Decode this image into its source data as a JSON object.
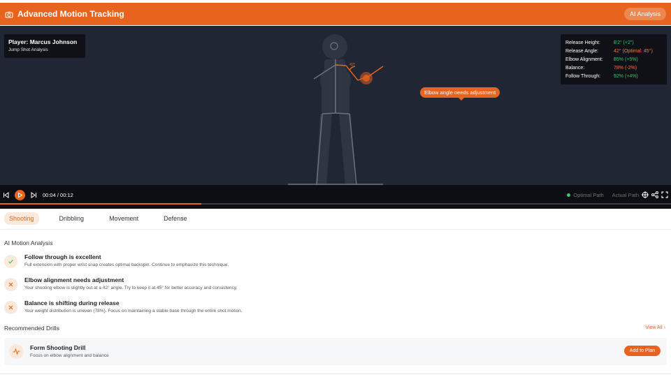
{
  "header": {
    "title": "Advanced Motion Tracking",
    "ai_button": "AI Analysis",
    "icon": "camera-icon"
  },
  "player": {
    "name": "Player: Marcus Johnson",
    "subtitle": "Jump Shot Analysis"
  },
  "metrics": [
    {
      "label": "Release Height:",
      "value": "8'2\"  (+2\")",
      "status": "good"
    },
    {
      "label": "Release Angle:",
      "value": "42°  (Optimal: 45°)",
      "status": "warn"
    },
    {
      "label": "Elbow Alignment:",
      "value": "85% (+5%)",
      "status": "good"
    },
    {
      "label": "Balance:",
      "value": "78% (-2%)",
      "status": "warn"
    },
    {
      "label": "Follow Through:",
      "value": "92% (+4%)",
      "status": "good"
    }
  ],
  "overlay": {
    "callout": "Elbow angle needs adjustment",
    "angle_label": "42°"
  },
  "controls": {
    "time": "00:04 / 00:12",
    "progress": 0.3,
    "legend_optimal": "Optimal Path",
    "legend_actual": "Actual Path"
  },
  "tabs": [
    "Shooting",
    "Dribbling",
    "Movement",
    "Defense"
  ],
  "active_tab": "Shooting",
  "analysis": {
    "title": "AI Motion Analysis",
    "items": [
      {
        "status": "ok",
        "icon": "check-icon",
        "title": "Follow through is excellent",
        "desc": "Full extension with proper wrist snap creates optimal backspin. Continue to emphasize this technique."
      },
      {
        "status": "warn",
        "icon": "x-icon",
        "title": "Elbow alignment needs adjustment",
        "desc": "Your shooting elbow is slightly out at a 42° angle. Try to keep it at 45° for better accuracy and consistency."
      },
      {
        "status": "warn",
        "icon": "x-icon",
        "title": "Balance is shifting during release",
        "desc": "Your weight distribution is uneven (78%). Focus on maintaining a stable base through the entire shot motion."
      }
    ]
  },
  "drills": {
    "title": "Recommended Drills",
    "view_all": "View All ›",
    "items": [
      {
        "title": "Form Shooting Drill",
        "desc": "Focus on elbow alignment and balance",
        "action": "Add to Plan",
        "icon": "activity-icon"
      }
    ]
  },
  "colors": {
    "accent": "#e8641e",
    "good": "#3cc46c",
    "video_bg": "#202634"
  }
}
